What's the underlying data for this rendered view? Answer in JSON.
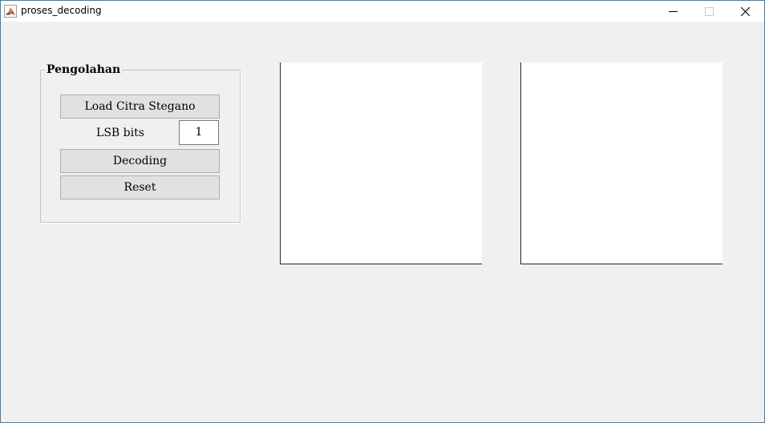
{
  "window": {
    "title": "proses_decoding"
  },
  "panel": {
    "title": "Pengolahan",
    "load_button": "Load Citra Stegano",
    "lsb_label": "LSB bits",
    "lsb_value": "1",
    "decode_button": "Decoding",
    "reset_button": "Reset"
  },
  "icons": {
    "app": "matlab-icon",
    "minimize": "minimize-icon",
    "maximize": "maximize-icon",
    "close": "close-icon"
  },
  "colors": {
    "window_border": "#3c7fb1",
    "background": "#f0f0f0",
    "button_face": "#e1e1e1"
  }
}
